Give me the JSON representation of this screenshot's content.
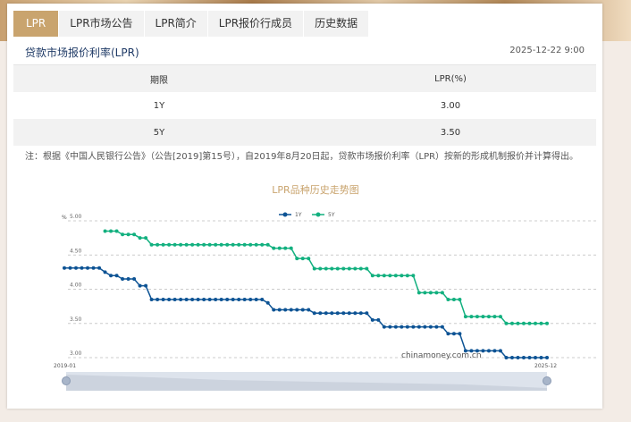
{
  "tabs": [
    "LPR",
    "LPR市场公告",
    "LPR简介",
    "LPR报价行成员",
    "历史数据"
  ],
  "title": "贷款市场报价利率(LPR)",
  "date": "2025-12-22 9:00",
  "table": {
    "headers": [
      "期限",
      "LPR(%)"
    ],
    "rows": [
      [
        "1Y",
        "3.00"
      ],
      [
        "5Y",
        "3.50"
      ]
    ]
  },
  "note": "注：根据《中国人民银行公告》（公告[2019]第15号），自2019年8月20日起，贷款市场报价利率（LPR）按新的形成机制报价并计算得出。",
  "chart_data": {
    "type": "line",
    "title": "LPR品种历史走势图",
    "ylabel": "%",
    "ylim": [
      3.0,
      5.0
    ],
    "yticks": [
      "5.00",
      "4.50",
      "4.00",
      "3.50",
      "3.00"
    ],
    "x_start": "2019-01",
    "x_end": "2025-12",
    "watermark": "chinamoney.com.cn",
    "legend": "top-center",
    "series": [
      {
        "name": "1Y",
        "color": "#0d5394",
        "runs": [
          [
            4.31,
            7
          ],
          [
            4.25,
            1
          ],
          [
            4.2,
            2
          ],
          [
            4.15,
            3
          ],
          [
            4.05,
            2
          ],
          [
            3.85,
            20
          ],
          [
            3.8,
            1
          ],
          [
            3.7,
            7
          ],
          [
            3.65,
            10
          ],
          [
            3.55,
            2
          ],
          [
            3.45,
            11
          ],
          [
            3.35,
            3
          ],
          [
            3.1,
            7
          ],
          [
            3.0,
            8
          ]
        ]
      },
      {
        "name": "5Y",
        "color": "#12b07f",
        "runs": [
          [
            null,
            7
          ],
          [
            4.85,
            3
          ],
          [
            4.8,
            3
          ],
          [
            4.75,
            2
          ],
          [
            4.65,
            21
          ],
          [
            4.6,
            4
          ],
          [
            4.45,
            3
          ],
          [
            4.3,
            10
          ],
          [
            4.2,
            8
          ],
          [
            3.95,
            5
          ],
          [
            3.85,
            3
          ],
          [
            3.6,
            7
          ],
          [
            3.5,
            8
          ]
        ]
      }
    ]
  }
}
